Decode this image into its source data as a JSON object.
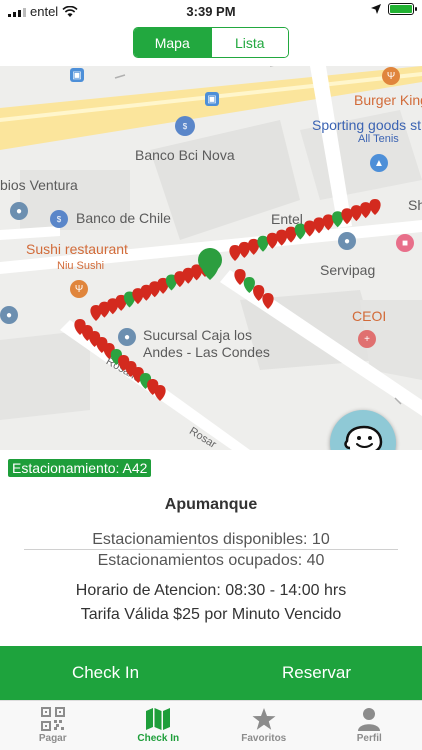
{
  "status_bar": {
    "carrier": "entel",
    "time": "3:39 PM"
  },
  "segmented": {
    "map_label": "Mapa",
    "list_label": "Lista"
  },
  "map": {
    "labels": {
      "burger_king": "Burger King",
      "sporting_goods": "Sporting goods st",
      "all_tenis": "All Tenis",
      "banco_bci": "Banco Bci Nova",
      "ventura": "bios Ventura",
      "banco_chile": "Banco de Chile",
      "sushi": "Sushi restaurant",
      "niu_sushi": "Niu Sushi",
      "entel": "Entel",
      "sh": "Sh",
      "servipag": "Servipag",
      "ceoi": "CEOI",
      "sucursal_1": "Sucursal Caja los",
      "sucursal_2": "Andes - Las Condes",
      "rosario_sur": "Rosario Sur",
      "rosario": "Rosar"
    }
  },
  "panel": {
    "badge": "Estacionamiento: A42",
    "title": "Apumanque",
    "available": "Estacionamientos disponibles: 10",
    "occupied": "Estacionamientos ocupados: 40",
    "hours": "Horario de Atencion: 08:30 - 14:00 hrs",
    "rate": "Tarifa Válida $25 por Minuto Vencido"
  },
  "actions": {
    "check_in": "Check In",
    "reserve": "Reservar"
  },
  "tabs": [
    {
      "label": "Pagar",
      "icon": "qr-code-icon"
    },
    {
      "label": "Check In",
      "icon": "map-icon"
    },
    {
      "label": "Favoritos",
      "icon": "star-icon"
    },
    {
      "label": "Perfil",
      "icon": "person-icon"
    }
  ],
  "colors": {
    "accent": "#1ea33d",
    "occupied_pin": "#d32a1e",
    "available_pin": "#2ca340",
    "waze": "#8fc9d6"
  }
}
